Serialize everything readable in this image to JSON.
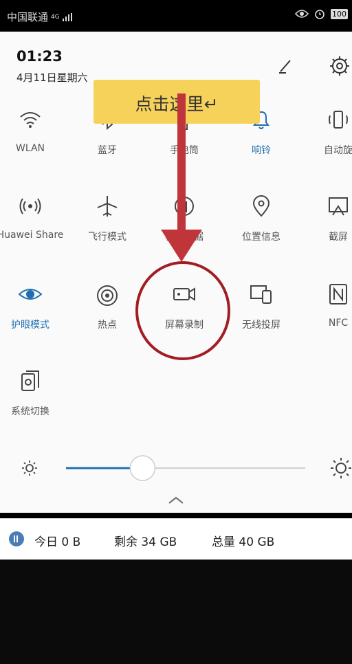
{
  "status_bar": {
    "carrier": "中国联通",
    "signal": "4G",
    "battery": "100"
  },
  "panel": {
    "time": "01:23",
    "date": "4月11日星期六"
  },
  "callout": {
    "text": "点击这里↵"
  },
  "tiles": [
    {
      "label": "WLAN",
      "icon": "wifi-icon",
      "active": false
    },
    {
      "label": "蓝牙",
      "icon": "bluetooth-icon",
      "active": false
    },
    {
      "label": "手电筒",
      "icon": "flashlight-icon",
      "active": false
    },
    {
      "label": "响铃",
      "icon": "bell-icon",
      "active": true
    },
    {
      "label": "自动旋",
      "icon": "auto-rotate-icon",
      "active": false
    },
    {
      "label": "Huawei Share",
      "icon": "huawei-share-icon",
      "active": false
    },
    {
      "label": "飞行模式",
      "icon": "airplane-icon",
      "active": false
    },
    {
      "label": "移动数据",
      "icon": "mobile-data-icon",
      "active": false
    },
    {
      "label": "位置信息",
      "icon": "location-icon",
      "active": false
    },
    {
      "label": "截屏",
      "icon": "screenshot-icon",
      "active": false
    },
    {
      "label": "护眼模式",
      "icon": "eye-icon",
      "active": true
    },
    {
      "label": "热点",
      "icon": "hotspot-icon",
      "active": false
    },
    {
      "label": "屏幕录制",
      "icon": "screen-record-icon",
      "active": false
    },
    {
      "label": "无线投屏",
      "icon": "wireless-projection-icon",
      "active": false
    },
    {
      "label": "NFC",
      "icon": "nfc-icon",
      "active": false
    },
    {
      "label": "系统切换",
      "icon": "system-switch-icon",
      "active": false
    }
  ],
  "brightness": {
    "level": 0.32
  },
  "storage": {
    "today": "今日 0 B",
    "remaining": "剩余 34 GB",
    "total": "总量 40 GB"
  },
  "colors": {
    "accent": "#1f6fb0",
    "arrow": "#c0353a",
    "callout": "#f7d25a"
  }
}
